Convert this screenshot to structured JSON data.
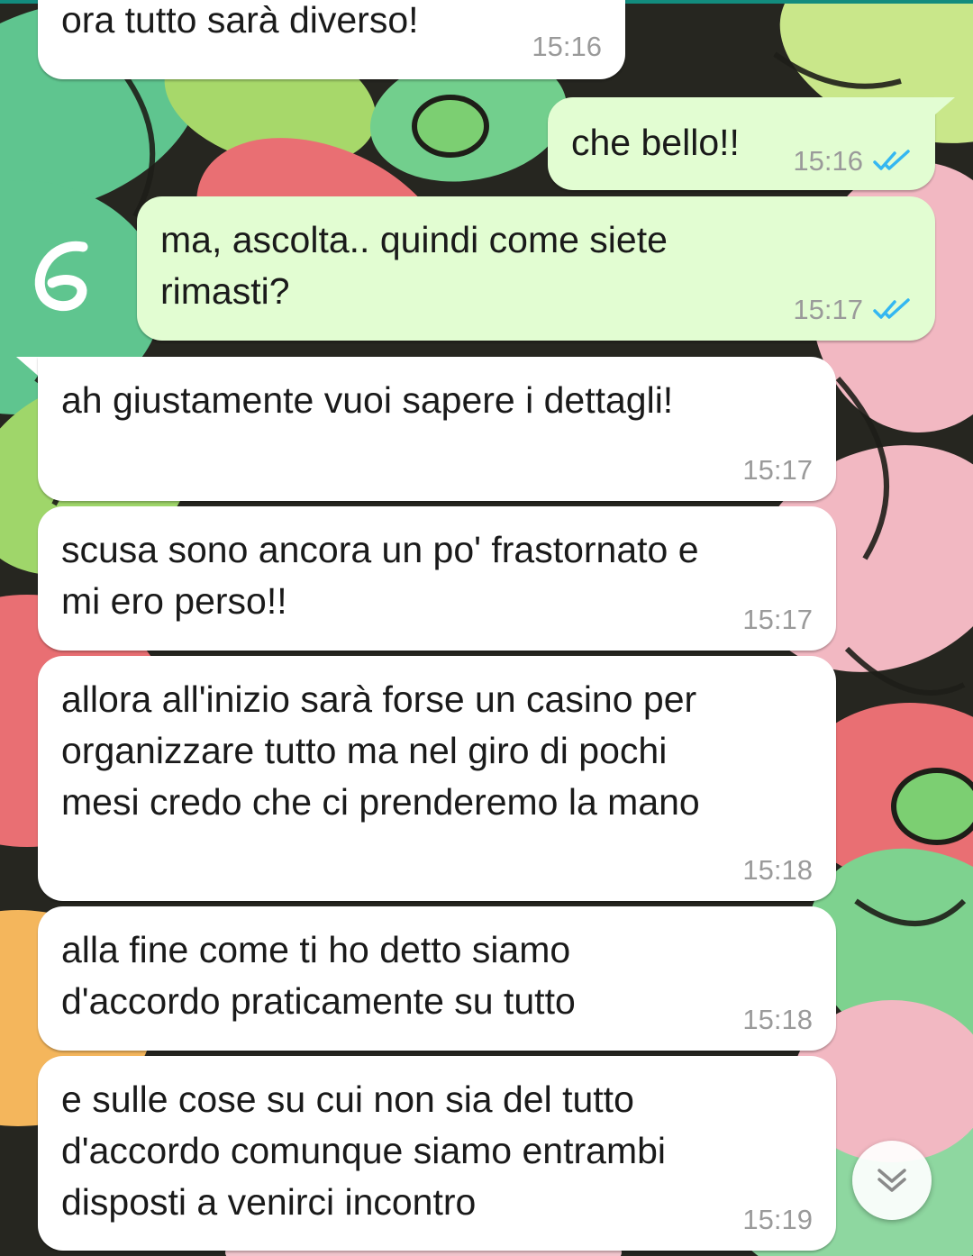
{
  "messages": [
    {
      "direction": "in",
      "text": "ora tutto sarà diverso!",
      "time": "15:16"
    },
    {
      "direction": "out",
      "text": "che bello!!",
      "time": "15:16",
      "status": "read"
    },
    {
      "direction": "out",
      "text": "ma, ascolta.. quindi come siete\nrimasti?",
      "time": "15:17",
      "status": "read"
    },
    {
      "direction": "in",
      "text": "ah giustamente vuoi sapere i dettagli!",
      "time": "15:17"
    },
    {
      "direction": "in",
      "text": "scusa sono ancora un po' frastornato e\nmi ero perso!!",
      "time": "15:17"
    },
    {
      "direction": "in",
      "text": "allora all'inizio sarà forse un casino per\norganizzare tutto ma nel giro di pochi\nmesi credo che ci prenderemo la mano",
      "time": "15:18"
    },
    {
      "direction": "in",
      "text": "alla fine come ti ho detto siamo\nd'accordo praticamente su tutto",
      "time": "15:18"
    },
    {
      "direction": "in",
      "text": "e sulle cose su cui non sia del tutto\nd'accordo comunque siamo entrambi\ndisposti a venirci incontro",
      "time": "15:19"
    }
  ],
  "icons": {
    "read_receipt": "double-check-icon",
    "scroll_down": "double-chevron-down-icon"
  },
  "colors": {
    "incoming_bubble": "#ffffff",
    "outgoing_bubble": "#e2fdd2",
    "read_ticks": "#34b7f1",
    "timestamp": "#9a9a9a"
  }
}
